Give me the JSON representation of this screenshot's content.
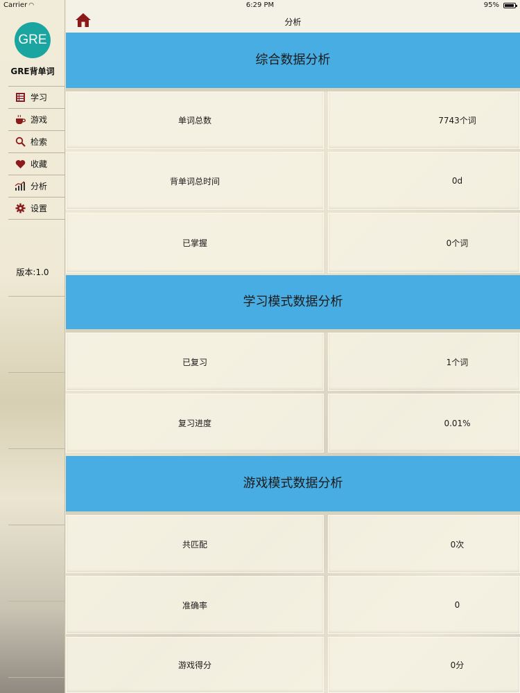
{
  "status_bar": {
    "carrier": "Carrier",
    "time": "6:29 PM",
    "battery": "95%"
  },
  "sidebar": {
    "logo_text": "GRE",
    "app_name": "GRE背单词",
    "items": [
      {
        "label": "学习",
        "icon": "book-icon"
      },
      {
        "label": "游戏",
        "icon": "coffee-cup-icon"
      },
      {
        "label": "检索",
        "icon": "search-icon"
      },
      {
        "label": "收藏",
        "icon": "heart-icon"
      },
      {
        "label": "分析",
        "icon": "bar-chart-icon"
      },
      {
        "label": "设置",
        "icon": "gear-icon"
      }
    ],
    "version": "版本:1.0"
  },
  "nav": {
    "title": "分析",
    "home_icon": "home-icon"
  },
  "sections": [
    {
      "title": "综合数据分析",
      "rows": [
        {
          "label": "单词总数",
          "value": "7743个词"
        },
        {
          "label": "背单词总时间",
          "value": "0d"
        },
        {
          "label": "已掌握",
          "value": "0个词"
        }
      ]
    },
    {
      "title": "学习模式数据分析",
      "rows": [
        {
          "label": "已复习",
          "value": "1个词"
        },
        {
          "label": "复习进度",
          "value": "0.01%"
        }
      ]
    },
    {
      "title": "游戏模式数据分析",
      "rows": [
        {
          "label": "共匹配",
          "value": "0次"
        },
        {
          "label": "准确率",
          "value": "0"
        },
        {
          "label": "游戏得分",
          "value": "0分"
        }
      ]
    }
  ],
  "colors": {
    "section_header": "#47ade3",
    "logo": "#1aa5a0",
    "home_icon": "#8b1a1a"
  }
}
